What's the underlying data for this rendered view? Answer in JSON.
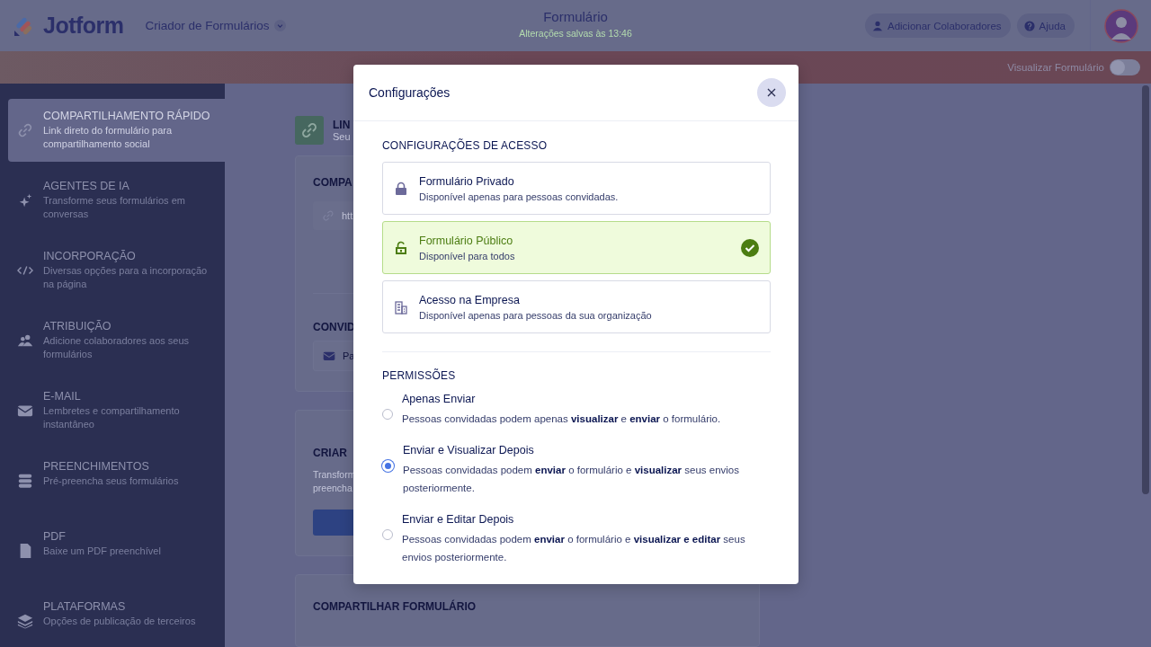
{
  "header": {
    "logo": "Jotform",
    "builder_menu": "Criador de Formulários",
    "title": "Formulário",
    "saved_status": "Alterações salvas às 13:46",
    "buttons": [
      "Adicionar Colaboradores",
      "Ajuda"
    ]
  },
  "tab_bar": {
    "preview_toggle": {
      "label": "Visualizar Formulário",
      "on": false
    }
  },
  "sidebar": {
    "items": [
      {
        "title": "COMPARTILHAMENTO RÁPIDO",
        "description": "Link direto do formulário para compartilhamento social",
        "selected": true
      },
      {
        "title": "AGENTES DE IA",
        "description": "Transforme seus formulários em conversas",
        "selected": false
      },
      {
        "title": "INCORPORAÇÃO",
        "description": "Diversas opções para a incorporação na página",
        "selected": false
      },
      {
        "title": "ATRIBUIÇÃO",
        "description": "Adicione colaboradores aos seus formulários",
        "selected": false
      },
      {
        "title": "E-MAIL",
        "description": "Lembretes e compartilhamento instantâneo",
        "selected": false
      },
      {
        "title": "PREENCHIMENTOS",
        "description": "Pré-preencha seus formulários",
        "selected": false
      },
      {
        "title": "PDF",
        "description": "Baixe um PDF preenchível",
        "selected": false
      },
      {
        "title": "PLATAFORMAS",
        "description": "Opções de publicação de terceiros",
        "selected": false
      }
    ]
  },
  "main": {
    "link_header": {
      "title": "LIN",
      "subtitle": "Seu"
    },
    "share_card": {
      "heading": "COMPA",
      "url": "htt",
      "invite_heading": "CONVID",
      "invite_field": "Pa"
    },
    "create_card": {
      "heading": "CRIAR",
      "description": [
        "Transform",
        "preencha"
      ]
    },
    "share_form_card": {
      "heading": "COMPARTILHAR FORMULÁRIO"
    }
  },
  "modal": {
    "title": "Configurações",
    "access": {
      "heading": "CONFIGURAÇÕES DE ACESSO",
      "options": [
        {
          "title": "Formulário Privado",
          "description": "Disponível apenas para pessoas convidadas.",
          "selected": false
        },
        {
          "title": "Formulário Público",
          "description": "Disponível para todos",
          "selected": true
        },
        {
          "title": "Acesso na Empresa",
          "description": "Disponível apenas para pessoas da sua organização",
          "selected": false
        }
      ]
    },
    "permissions": {
      "heading": "PERMISSÕES",
      "options": [
        {
          "title": "Apenas Enviar",
          "description": "Pessoas convidadas podem apenas **visualizar** e **enviar** o formulário.",
          "selected": false
        },
        {
          "title": "Enviar e Visualizar Depois",
          "description": "Pessoas convidadas podem **enviar** o formulário e **visualizar** seus envios posteriormente.",
          "selected": true
        },
        {
          "title": "Enviar e Editar Depois",
          "description": "Pessoas convidadas podem **enviar** o formulário e **visualizar e editar** seus envios posteriormente.",
          "selected": false
        }
      ]
    }
  }
}
